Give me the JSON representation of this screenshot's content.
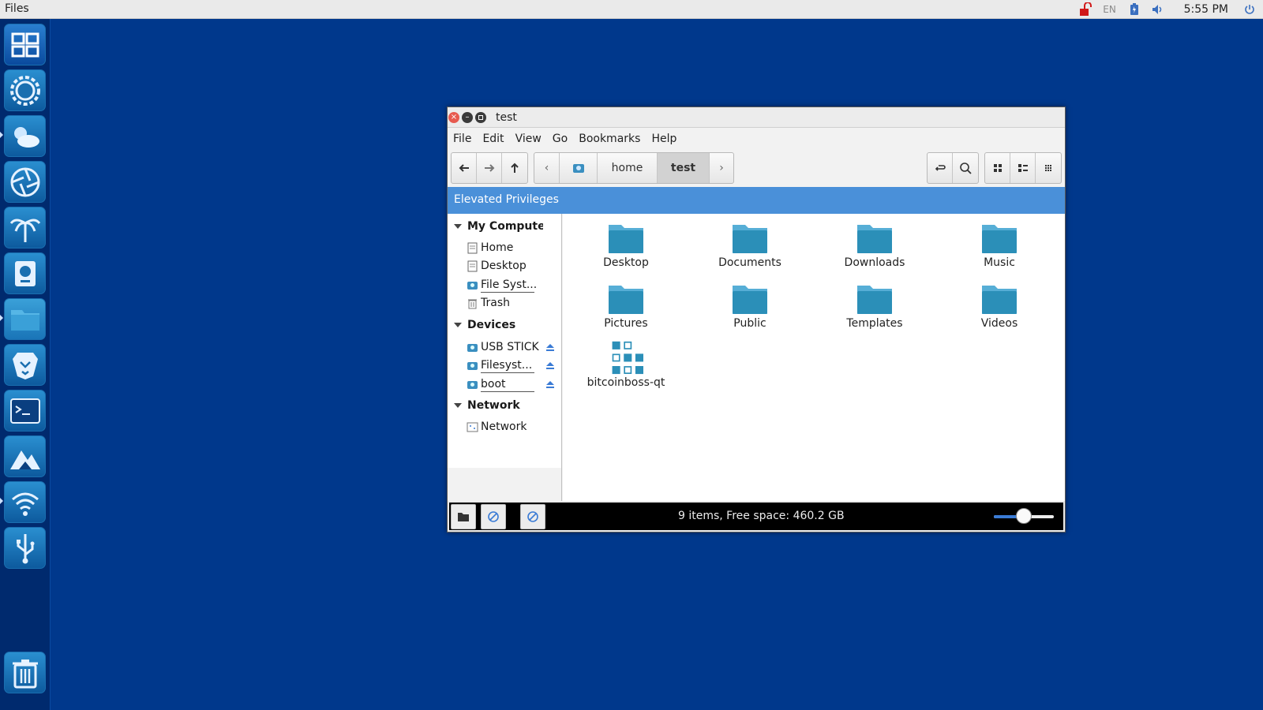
{
  "top_panel": {
    "app_name": "Files",
    "tray": {
      "lang": "EN",
      "clock": "5:55 PM"
    }
  },
  "dock": {
    "items": [
      {
        "name": "boss-logo-icon"
      },
      {
        "name": "settings-gear-icon"
      },
      {
        "name": "weather-icon"
      },
      {
        "name": "aperture-icon"
      },
      {
        "name": "palm-tree-icon"
      },
      {
        "name": "disk-utility-icon"
      },
      {
        "name": "files-folder-icon"
      },
      {
        "name": "brave-lion-icon"
      },
      {
        "name": "terminal-icon"
      },
      {
        "name": "mountain-icon"
      },
      {
        "name": "wifi-icon"
      },
      {
        "name": "usb-icon"
      },
      {
        "name": "trash-icon"
      }
    ]
  },
  "window": {
    "title": "test",
    "menu": [
      "File",
      "Edit",
      "View",
      "Go",
      "Bookmarks",
      "Help"
    ],
    "breadcrumb": {
      "home": "home",
      "current": "test"
    },
    "privilege_banner": "Elevated Privileges",
    "sidebar": {
      "sections": [
        {
          "title": "My Computer",
          "items": [
            "Home",
            "Desktop",
            "File Syst...",
            "Trash"
          ]
        },
        {
          "title": "Devices",
          "items": [
            "USB STICK",
            "Filesyst...",
            "boot"
          ]
        },
        {
          "title": "Network",
          "items": [
            "Network"
          ]
        }
      ]
    },
    "files": [
      {
        "name": "Desktop",
        "type": "folder"
      },
      {
        "name": "Documents",
        "type": "folder"
      },
      {
        "name": "Downloads",
        "type": "folder"
      },
      {
        "name": "Music",
        "type": "folder"
      },
      {
        "name": "Pictures",
        "type": "folder"
      },
      {
        "name": "Public",
        "type": "folder"
      },
      {
        "name": "Templates",
        "type": "folder"
      },
      {
        "name": "Videos",
        "type": "folder"
      },
      {
        "name": "bitcoinboss-qt",
        "type": "executable"
      }
    ],
    "status": "9 items, Free space: 460.2 GB",
    "zoom_level": 0.5
  },
  "colors": {
    "desktop": "#00388c",
    "accent": "#4a90d9",
    "folder": "#2b8fb8"
  }
}
